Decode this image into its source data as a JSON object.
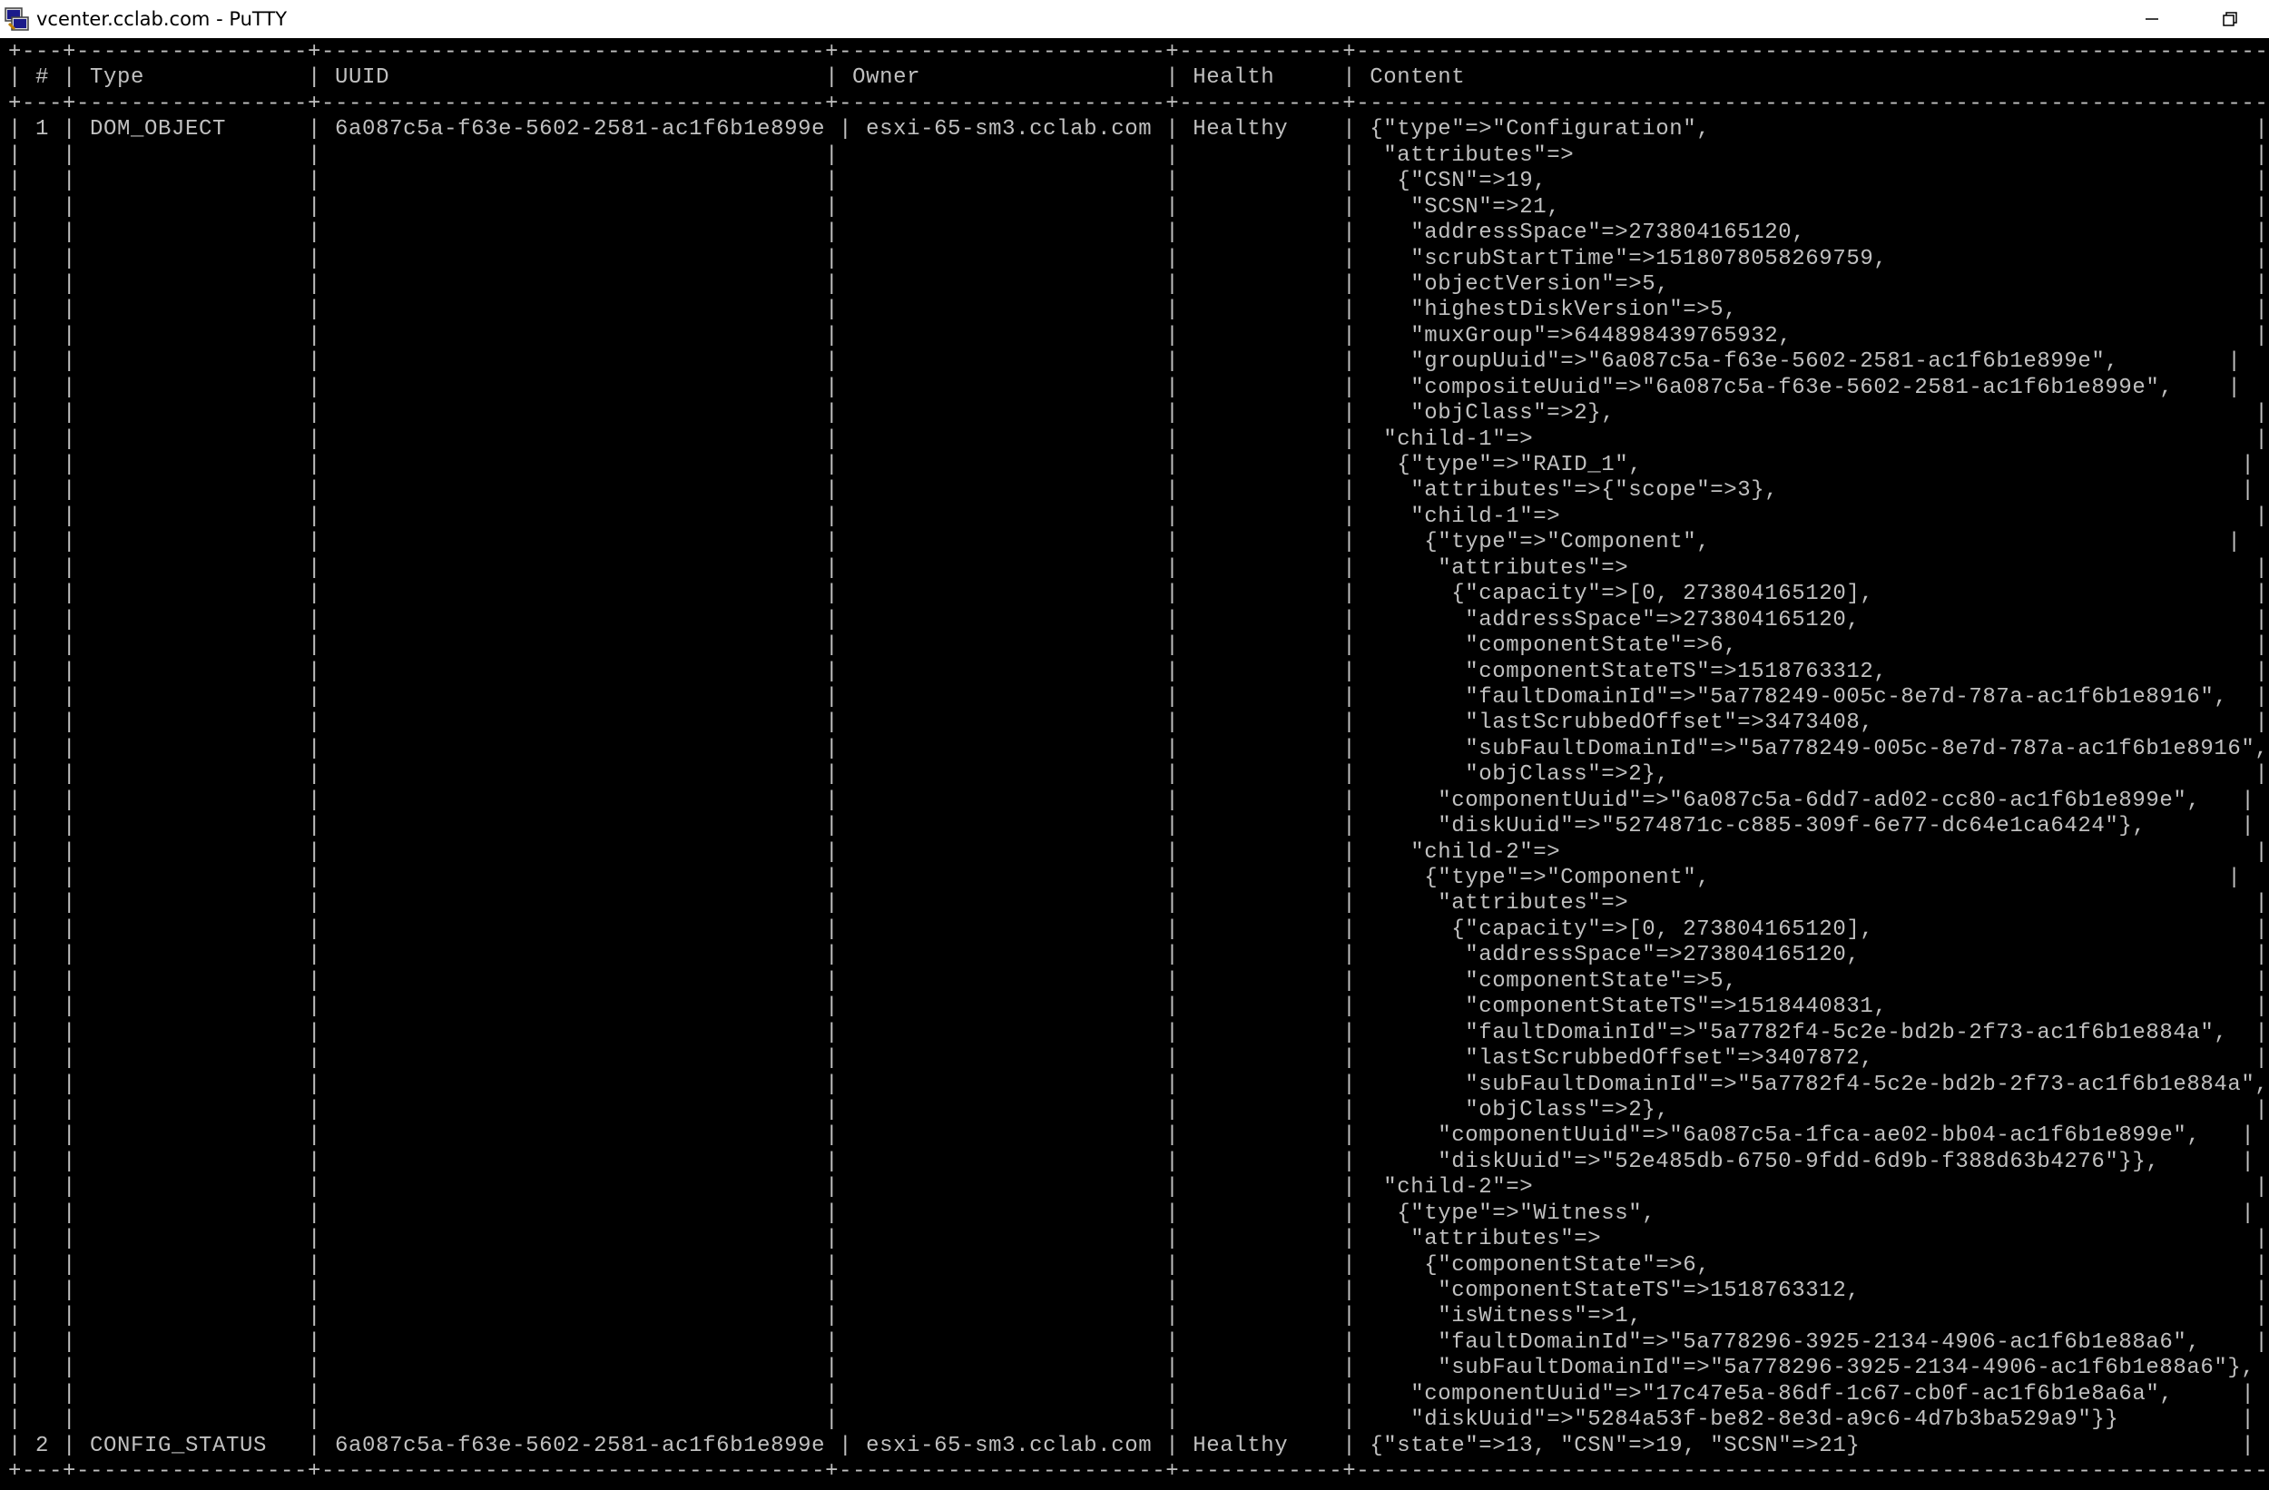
{
  "window": {
    "title": "vcenter.cclab.com - PuTTY",
    "icon": "putty-terminal-icon",
    "buttons": [
      "minimize",
      "restore"
    ]
  },
  "colors": {
    "terminal_bg": "#000000",
    "terminal_fg": "#c0c0c0",
    "titlebar_bg": "#ffffff"
  },
  "terminal": {
    "lines": [
      "+---+-----------------+-------------------------------------+------------------------+------------+-------------------------------------------------------------------+",
      "| # | Type            | UUID                                | Owner                  | Health     | Content                                                           |",
      "+---+-----------------+-------------------------------------+------------------------+------------+-------------------------------------------------------------------+",
      "| 1 | DOM_OBJECT      | 6a087c5a-f63e-5602-2581-ac1f6b1e899e | esxi-65-sm3.cclab.com | Healthy    | {\"type\"=>\"Configuration\",                                        |",
      "|   |                 |                                     |                        |            |  \"attributes\"=>                                                  |",
      "|   |                 |                                     |                        |            |   {\"CSN\"=>19,                                                    |",
      "|   |                 |                                     |                        |            |    \"SCSN\"=>21,                                                   |",
      "|   |                 |                                     |                        |            |    \"addressSpace\"=>273804165120,                                 |",
      "|   |                 |                                     |                        |            |    \"scrubStartTime\"=>1518078058269759,                           |",
      "|   |                 |                                     |                        |            |    \"objectVersion\"=>5,                                           |",
      "|   |                 |                                     |                        |            |    \"highestDiskVersion\"=>5,                                      |",
      "|   |                 |                                     |                        |            |    \"muxGroup\"=>644898439765932,                                  |",
      "|   |                 |                                     |                        |            |    \"groupUuid\"=>\"6a087c5a-f63e-5602-2581-ac1f6b1e899e\",        |",
      "|   |                 |                                     |                        |            |    \"compositeUuid\"=>\"6a087c5a-f63e-5602-2581-ac1f6b1e899e\",    |",
      "|   |                 |                                     |                        |            |    \"objClass\"=>2},                                               |",
      "|   |                 |                                     |                        |            |  \"child-1\"=>                                                     |",
      "|   |                 |                                     |                        |            |   {\"type\"=>\"RAID_1\",                                            |",
      "|   |                 |                                     |                        |            |    \"attributes\"=>{\"scope\"=>3},                                  |",
      "|   |                 |                                     |                        |            |    \"child-1\"=>                                                   |",
      "|   |                 |                                     |                        |            |     {\"type\"=>\"Component\",                                      |",
      "|   |                 |                                     |                        |            |      \"attributes\"=>                                              |",
      "|   |                 |                                     |                        |            |       {\"capacity\"=>[0, 273804165120],                            |",
      "|   |                 |                                     |                        |            |        \"addressSpace\"=>273804165120,                             |",
      "|   |                 |                                     |                        |            |        \"componentState\"=>6,                                      |",
      "|   |                 |                                     |                        |            |        \"componentStateTS\"=>1518763312,                           |",
      "|   |                 |                                     |                        |            |        \"faultDomainId\"=>\"5a778249-005c-8e7d-787a-ac1f6b1e8916\",  |",
      "|   |                 |                                     |                        |            |        \"lastScrubbedOffset\"=>3473408,                            |",
      "|   |                 |                                     |                        |            |        \"subFaultDomainId\"=>\"5a778249-005c-8e7d-787a-ac1f6b1e8916\",|",
      "|   |                 |                                     |                        |            |        \"objClass\"=>2},                                           |",
      "|   |                 |                                     |                        |            |      \"componentUuid\"=>\"6a087c5a-6dd7-ad02-cc80-ac1f6b1e899e\",   |",
      "|   |                 |                                     |                        |            |      \"diskUuid\"=>\"5274871c-c885-309f-6e77-dc64e1ca6424\"},       |",
      "|   |                 |                                     |                        |            |    \"child-2\"=>                                                   |",
      "|   |                 |                                     |                        |            |     {\"type\"=>\"Component\",                                      |",
      "|   |                 |                                     |                        |            |      \"attributes\"=>                                              |",
      "|   |                 |                                     |                        |            |       {\"capacity\"=>[0, 273804165120],                            |",
      "|   |                 |                                     |                        |            |        \"addressSpace\"=>273804165120,                             |",
      "|   |                 |                                     |                        |            |        \"componentState\"=>5,                                      |",
      "|   |                 |                                     |                        |            |        \"componentStateTS\"=>1518440831,                           |",
      "|   |                 |                                     |                        |            |        \"faultDomainId\"=>\"5a7782f4-5c2e-bd2b-2f73-ac1f6b1e884a\",  |",
      "|   |                 |                                     |                        |            |        \"lastScrubbedOffset\"=>3407872,                            |",
      "|   |                 |                                     |                        |            |        \"subFaultDomainId\"=>\"5a7782f4-5c2e-bd2b-2f73-ac1f6b1e884a\",|",
      "|   |                 |                                     |                        |            |        \"objClass\"=>2},                                           |",
      "|   |                 |                                     |                        |            |      \"componentUuid\"=>\"6a087c5a-1fca-ae02-bb04-ac1f6b1e899e\",   |",
      "|   |                 |                                     |                        |            |      \"diskUuid\"=>\"52e485db-6750-9fdd-6d9b-f388d63b4276\"}},      |",
      "|   |                 |                                     |                        |            |  \"child-2\"=>                                                     |",
      "|   |                 |                                     |                        |            |   {\"type\"=>\"Witness\",                                           |",
      "|   |                 |                                     |                        |            |    \"attributes\"=>                                                |",
      "|   |                 |                                     |                        |            |     {\"componentState\"=>6,                                        |",
      "|   |                 |                                     |                        |            |      \"componentStateTS\"=>1518763312,                             |",
      "|   |                 |                                     |                        |            |      \"isWitness\"=>1,                                             |",
      "|   |                 |                                     |                        |            |      \"faultDomainId\"=>\"5a778296-3925-2134-4906-ac1f6b1e88a6\",    |",
      "|   |                 |                                     |                        |            |      \"subFaultDomainId\"=>\"5a778296-3925-2134-4906-ac1f6b1e88a6\"}, |",
      "|   |                 |                                     |                        |            |    \"componentUuid\"=>\"17c47e5a-86df-1c67-cb0f-ac1f6b1e8a6a\",     |",
      "|   |                 |                                     |                        |            |    \"diskUuid\"=>\"5284a53f-be82-8e3d-a9c6-4d7b3ba529a9\"}}         |",
      "| 2 | CONFIG_STATUS   | 6a087c5a-f63e-5602-2581-ac1f6b1e899e | esxi-65-sm3.cclab.com | Healthy    | {\"state\"=>13, \"CSN\"=>19, \"SCSN\"=>21}                            |",
      "+---+-----------------+-------------------------------------+------------------------+------------+-------------------------------------------------------------------+"
    ]
  }
}
